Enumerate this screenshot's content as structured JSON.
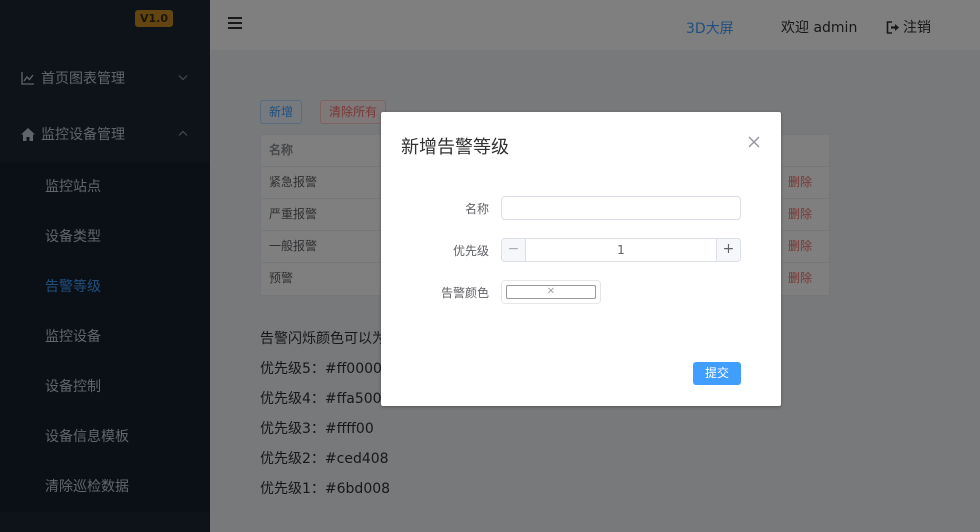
{
  "sidebar": {
    "version": "V1.0",
    "groups": [
      {
        "label": "首页图表管理",
        "icon": "line-chart-icon",
        "expanded": false
      },
      {
        "label": "监控设备管理",
        "icon": "home-icon",
        "expanded": true
      }
    ],
    "sub_items": [
      {
        "label": "监控站点",
        "active": false
      },
      {
        "label": "设备类型",
        "active": false
      },
      {
        "label": "告警等级",
        "active": true
      },
      {
        "label": "监控设备",
        "active": false
      },
      {
        "label": "设备控制",
        "active": false
      },
      {
        "label": "设备信息模板",
        "active": false
      },
      {
        "label": "清除巡检数据",
        "active": false
      }
    ]
  },
  "header": {
    "link_3d": "3D大屏",
    "welcome": "欢迎 admin",
    "logout": "注销"
  },
  "toolbar": {
    "add_label": "新增",
    "clear_label": "清除所有"
  },
  "table": {
    "header_name": "名称",
    "rows": [
      {
        "name": "紧急报警",
        "delete": "删除"
      },
      {
        "name": "严重报警",
        "delete": "删除"
      },
      {
        "name": "一般报警",
        "delete": "删除"
      },
      {
        "name": "预警",
        "delete": "删除"
      }
    ]
  },
  "notes": {
    "intro": "告警闪烁颜色可以为",
    "lines": [
      "优先级5：#ff0000",
      "优先级4：#ffa500",
      "优先级3：#ffff00",
      "优先级2：#ced408",
      "优先级1：#6bd008"
    ]
  },
  "dialog": {
    "title": "新增告警等级",
    "name_label": "名称",
    "name_value": "",
    "priority_label": "优先级",
    "priority_value": "1",
    "minus": "−",
    "plus": "+",
    "color_label": "告警颜色",
    "color_empty": "×",
    "submit_label": "提交"
  },
  "colors": {
    "accent": "#409eff",
    "danger": "#f56c6c",
    "sidebar_bg": "#1d2633",
    "badge": "#c58a22"
  }
}
